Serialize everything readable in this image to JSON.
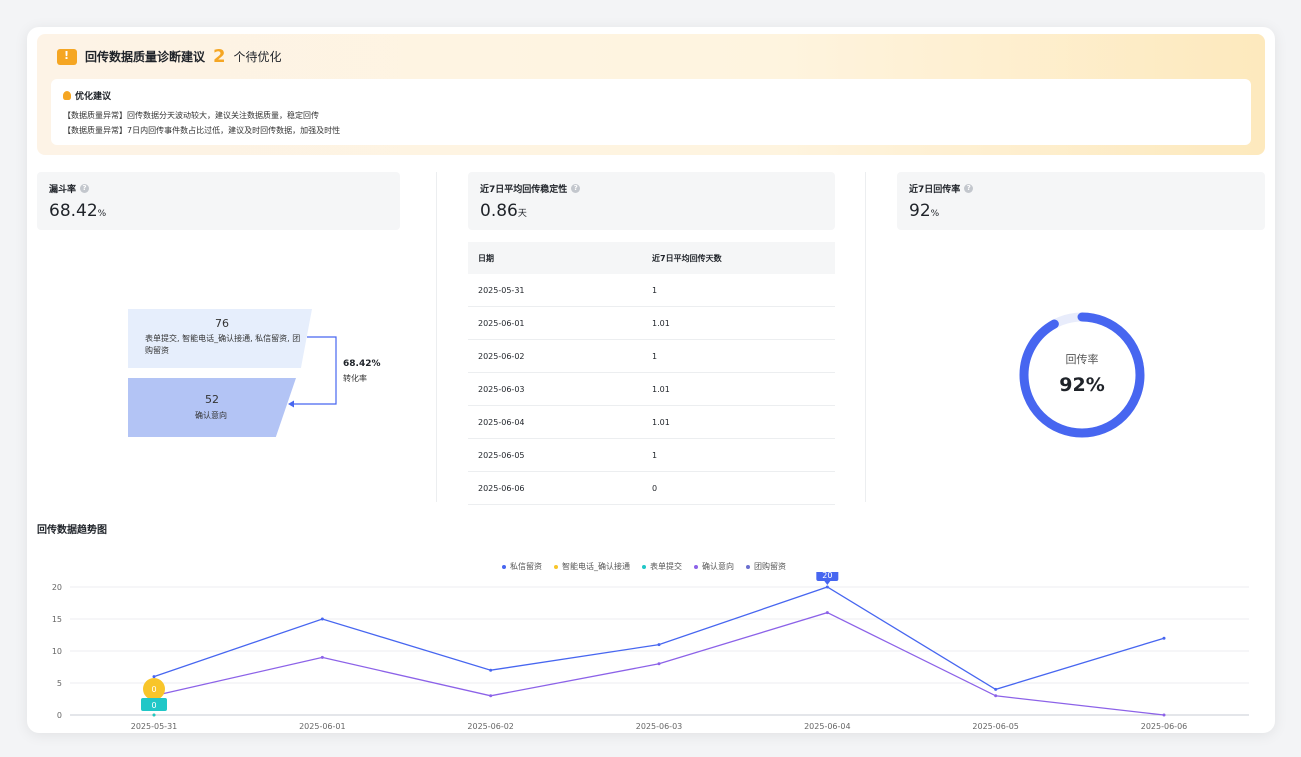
{
  "banner": {
    "title": "回传数据质量诊断建议",
    "count": "2",
    "count_suffix": "个待优化",
    "suggest_title": "优化建议",
    "suggestions": [
      "【数据质量异常】回传数据分天波动较大，建议关注数据质量，稳定回传",
      "【数据质量异常】7日内回传事件数占比过低，建议及时回传数据，加强及时性"
    ]
  },
  "metrics": {
    "funnel": {
      "label": "漏斗率",
      "value": "68.42",
      "unit": "%"
    },
    "stability": {
      "label": "近7日平均回传稳定性",
      "value": "0.86",
      "unit": "天"
    },
    "rate": {
      "label": "近7日回传率",
      "value": "92",
      "unit": "%"
    }
  },
  "funnel": {
    "top_value": "76",
    "top_label": "表单提交, 智能电话_确认接通, 私信留资, 团购留资",
    "bottom_value": "52",
    "bottom_label": "确认意向",
    "conversion_rate": "68.42%",
    "conversion_label": "转化率"
  },
  "table": {
    "headers": [
      "日期",
      "近7日平均回传天数"
    ],
    "rows": [
      [
        "2025-05-31",
        "1"
      ],
      [
        "2025-06-01",
        "1.01"
      ],
      [
        "2025-06-02",
        "1"
      ],
      [
        "2025-06-03",
        "1.01"
      ],
      [
        "2025-06-04",
        "1.01"
      ],
      [
        "2025-06-05",
        "1"
      ],
      [
        "2025-06-06",
        "0"
      ]
    ]
  },
  "gauge": {
    "label": "回传率",
    "value_text": "92%",
    "fraction": 0.92
  },
  "trend": {
    "title": "回传数据趋势图"
  },
  "chart_data": {
    "type": "line",
    "x": [
      "2025-05-31",
      "2025-06-01",
      "2025-06-02",
      "2025-06-03",
      "2025-06-04",
      "2025-06-05",
      "2025-06-06"
    ],
    "yticks": [
      0,
      5,
      10,
      15,
      20
    ],
    "ylim": [
      0,
      20
    ],
    "grid": true,
    "legend_position": "top-center",
    "series": [
      {
        "name": "私信留资",
        "color": "#4766f0",
        "values": [
          6,
          15,
          7,
          11,
          20,
          4,
          12
        ]
      },
      {
        "name": "智能电话_确认接通",
        "color": "#f8c52a",
        "values": [
          0,
          null,
          null,
          null,
          null,
          null,
          null
        ]
      },
      {
        "name": "表单提交",
        "color": "#20c7c7",
        "values": [
          0,
          null,
          null,
          null,
          null,
          null,
          null
        ]
      },
      {
        "name": "确认意向",
        "color": "#8c62e8",
        "values": [
          3,
          9,
          3,
          8,
          16,
          3,
          0
        ]
      },
      {
        "name": "团购留资",
        "color": "#6b6fcf",
        "values": [
          null,
          null,
          null,
          null,
          null,
          null,
          null
        ]
      }
    ],
    "labels": [
      {
        "series": "私信留资",
        "x": "2025-06-04",
        "text": "20"
      },
      {
        "series": "智能电话_确认接通",
        "x": "2025-05-31",
        "text": "0"
      },
      {
        "series": "表单提交",
        "x": "2025-05-31",
        "text": "0"
      }
    ]
  }
}
